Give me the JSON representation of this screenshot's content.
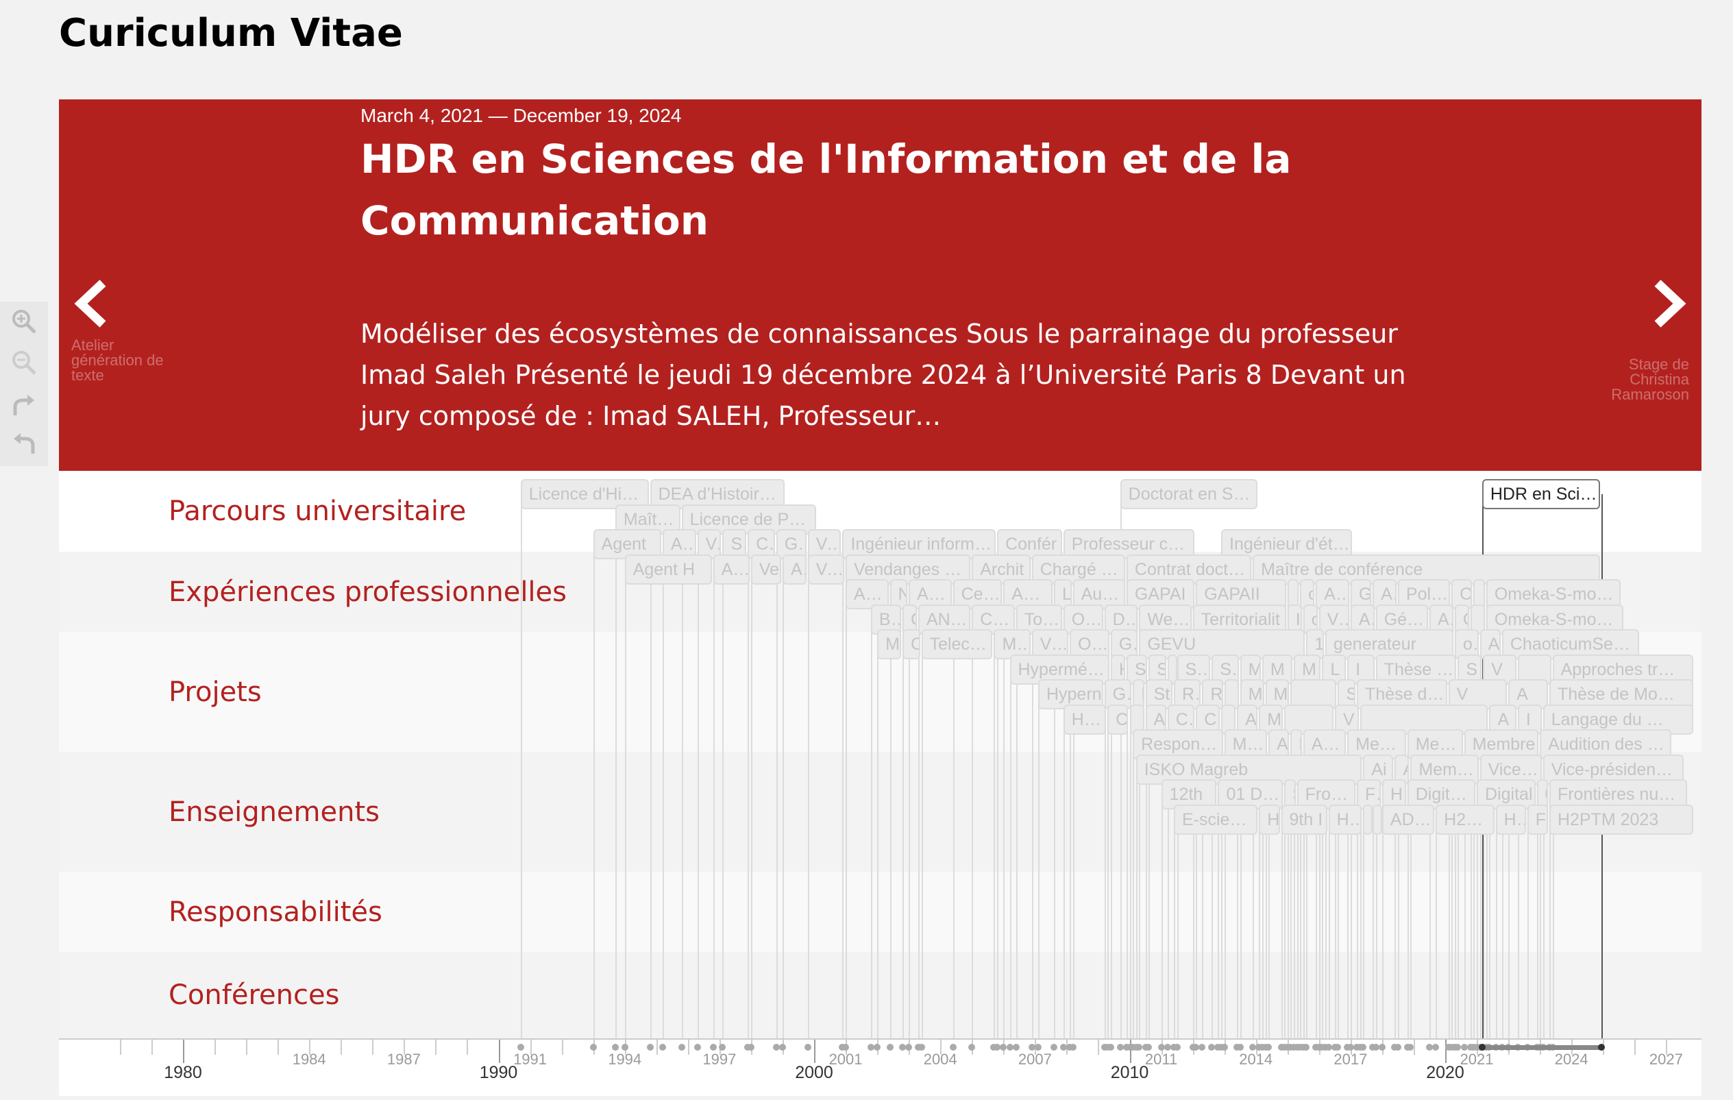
{
  "page_title": "Curiculum Vitae",
  "slide": {
    "date_start": "March 4, 2021",
    "date_sep": "—",
    "date_end": "December 19, 2024",
    "headline": "HDR en Sciences de l'Information et de la Communication",
    "description": "Modéliser des écosystèmes de connaissances Sous le parrainage du professeur Imad Saleh Présenté le jeudi 19 décembre 2024 à l’Université Paris 8 Devant un jury composé de : Imad SALEH, Professeur…",
    "prev": {
      "icon": "chevron-left-icon",
      "label": "Atelier génération de texte"
    },
    "next": {
      "icon": "chevron-right-icon",
      "label": "Stage de Christina Ramaroson"
    }
  },
  "zoom_tools": [
    "zoom-in-icon",
    "zoom-out-icon",
    "redo-icon",
    "undo-icon"
  ],
  "groups": [
    {
      "label": "Parcours universitaire"
    },
    {
      "label": "Expériences professionnelles"
    },
    {
      "label": "Projets"
    },
    {
      "label": "Enseignements"
    },
    {
      "label": "Responsabilités"
    },
    {
      "label": "Conférences"
    }
  ],
  "timeline": {
    "start_year": 1976.0,
    "end_year": 2028.0,
    "active_event": {
      "text": "HDR en Scien…",
      "start": 2021.17,
      "end": 2024.96
    },
    "events": [
      {
        "row": 0,
        "text": "Licence d'Hist…",
        "start": 1990.7,
        "end": 1994.8
      },
      {
        "row": 0,
        "text": "DEA d’Histoir…",
        "start": 1994.8,
        "end": 1999.1
      },
      {
        "row": 0,
        "text": "Doctorat en S…",
        "start": 2009.7,
        "end": 2014.1
      },
      {
        "row": 1,
        "text": "Maîtrise",
        "start": 1993.7,
        "end": 1995.8
      },
      {
        "row": 1,
        "text": "Licence de Ph…",
        "start": 1995.8,
        "end": 2000.1
      },
      {
        "row": 2,
        "text": "Agent",
        "start": 1993.0,
        "end": 1995.2
      },
      {
        "row": 2,
        "text": "Agen",
        "start": 1995.2,
        "end": 1996.3
      },
      {
        "row": 2,
        "text": "Ve",
        "start": 1996.3,
        "end": 1997.1
      },
      {
        "row": 2,
        "text": "Se",
        "start": 1997.1,
        "end": 1997.9
      },
      {
        "row": 2,
        "text": "Ch",
        "start": 1997.9,
        "end": 1998.8
      },
      {
        "row": 2,
        "text": "Gui",
        "start": 1998.8,
        "end": 1999.8
      },
      {
        "row": 2,
        "text": "Vend",
        "start": 1999.8,
        "end": 2000.9
      },
      {
        "row": 2,
        "text": "Ingénieur inform…",
        "start": 2000.9,
        "end": 2005.8
      },
      {
        "row": 2,
        "text": "Confér",
        "start": 2005.8,
        "end": 2007.9
      },
      {
        "row": 2,
        "text": "Professeur co…",
        "start": 2007.9,
        "end": 2012.1
      },
      {
        "row": 2,
        "text": "Ingénieur d'ét…",
        "start": 2012.9,
        "end": 2017.1
      },
      {
        "row": 3,
        "text": "Agent H",
        "start": 1994.0,
        "end": 1996.8
      },
      {
        "row": 3,
        "text": "Age",
        "start": 1996.8,
        "end": 1998.0
      },
      {
        "row": 3,
        "text": "Ve",
        "start": 1998.0,
        "end": 1999.0
      },
      {
        "row": 3,
        "text": "Ar",
        "start": 1999.0,
        "end": 1999.8
      },
      {
        "row": 3,
        "text": "Vendan",
        "start": 1999.8,
        "end": 2001.0
      },
      {
        "row": 3,
        "text": "Vendanges e…",
        "start": 2001.0,
        "end": 2005.0
      },
      {
        "row": 3,
        "text": "Archit",
        "start": 2005.0,
        "end": 2006.9
      },
      {
        "row": 3,
        "text": "Chargé de c",
        "start": 2006.9,
        "end": 2009.9
      },
      {
        "row": 3,
        "text": "Contrat docto…",
        "start": 2009.9,
        "end": 2013.9
      },
      {
        "row": 3,
        "text": "Maître de conférence",
        "start": 2013.9,
        "end": 2024.96
      },
      {
        "row": 4,
        "text": "Agen",
        "start": 2001.0,
        "end": 2002.4
      },
      {
        "row": 4,
        "text": "N",
        "start": 2002.4,
        "end": 2003.0
      },
      {
        "row": 4,
        "text": "ANPE",
        "start": 2003.0,
        "end": 2004.4
      },
      {
        "row": 4,
        "text": "Cegete",
        "start": 2004.4,
        "end": 2006.0
      },
      {
        "row": 4,
        "text": "ANPE",
        "start": 2006.0,
        "end": 2007.6
      },
      {
        "row": 4,
        "text": "Li",
        "start": 2007.6,
        "end": 2008.2
      },
      {
        "row": 4,
        "text": "Autom",
        "start": 2008.2,
        "end": 2009.9
      },
      {
        "row": 4,
        "text": "GAPAI",
        "start": 2009.9,
        "end": 2012.1
      },
      {
        "row": 4,
        "text": "GAPAII",
        "start": 2012.1,
        "end": 2015.0
      },
      {
        "row": 4,
        "text": "",
        "start": 2015.0,
        "end": 2015.4
      },
      {
        "row": 4,
        "text": "c",
        "start": 2015.4,
        "end": 2015.9
      },
      {
        "row": 4,
        "text": "Ate",
        "start": 2015.9,
        "end": 2017.0
      },
      {
        "row": 4,
        "text": "Ge",
        "start": 2017.0,
        "end": 2017.7
      },
      {
        "row": 4,
        "text": "AD",
        "start": 2017.7,
        "end": 2018.5
      },
      {
        "row": 4,
        "text": "Polem",
        "start": 2018.5,
        "end": 2020.2
      },
      {
        "row": 4,
        "text": "O",
        "start": 2020.2,
        "end": 2020.9
      },
      {
        "row": 4,
        "text": "",
        "start": 2020.9,
        "end": 2021.3
      },
      {
        "row": 4,
        "text": "Omeka-S-mo…",
        "start": 2021.3,
        "end": 2025.6
      },
      {
        "row": 5,
        "text": "Ba",
        "start": 2001.8,
        "end": 2002.8
      },
      {
        "row": 5,
        "text": "C",
        "start": 2002.8,
        "end": 2003.3
      },
      {
        "row": 5,
        "text": "ANPE -",
        "start": 2003.3,
        "end": 2005.0
      },
      {
        "row": 5,
        "text": "Cege",
        "start": 2005.0,
        "end": 2006.4
      },
      {
        "row": 5,
        "text": "Touri",
        "start": 2006.4,
        "end": 2007.9
      },
      {
        "row": 5,
        "text": "Outil",
        "start": 2007.9,
        "end": 2009.2
      },
      {
        "row": 5,
        "text": "Diag",
        "start": 2009.2,
        "end": 2010.3
      },
      {
        "row": 5,
        "text": "WebSt",
        "start": 2010.3,
        "end": 2012.0
      },
      {
        "row": 5,
        "text": "Territorialit",
        "start": 2012.0,
        "end": 2015.0
      },
      {
        "row": 5,
        "text": "I",
        "start": 2015.0,
        "end": 2015.5
      },
      {
        "row": 5,
        "text": "o",
        "start": 2015.5,
        "end": 2016.0
      },
      {
        "row": 5,
        "text": "Vis",
        "start": 2016.0,
        "end": 2017.0
      },
      {
        "row": 5,
        "text": "At",
        "start": 2017.0,
        "end": 2017.8
      },
      {
        "row": 5,
        "text": "Génér",
        "start": 2017.8,
        "end": 2019.5
      },
      {
        "row": 5,
        "text": "Ar",
        "start": 2019.5,
        "end": 2020.3
      },
      {
        "row": 5,
        "text": "C",
        "start": 2020.3,
        "end": 2020.8
      },
      {
        "row": 5,
        "text": "",
        "start": 2020.8,
        "end": 2021.3
      },
      {
        "row": 5,
        "text": "Omeka-S-mo…",
        "start": 2021.3,
        "end": 2025.7
      },
      {
        "row": 6,
        "text": "M",
        "start": 2002.0,
        "end": 2002.8
      },
      {
        "row": 6,
        "text": "C",
        "start": 2002.8,
        "end": 2003.4
      },
      {
        "row": 6,
        "text": "Telecom",
        "start": 2003.4,
        "end": 2005.7
      },
      {
        "row": 6,
        "text": "MUI",
        "start": 2005.7,
        "end": 2006.9
      },
      {
        "row": 6,
        "text": "Visit",
        "start": 2006.9,
        "end": 2008.1
      },
      {
        "row": 6,
        "text": "Onad",
        "start": 2008.1,
        "end": 2009.4
      },
      {
        "row": 6,
        "text": "Ges",
        "start": 2009.4,
        "end": 2010.3
      },
      {
        "row": 6,
        "text": "GEVU",
        "start": 2010.3,
        "end": 2015.6
      },
      {
        "row": 6,
        "text": "1",
        "start": 2015.6,
        "end": 2016.2
      },
      {
        "row": 6,
        "text": "generateur",
        "start": 2016.2,
        "end": 2020.3
      },
      {
        "row": 6,
        "text": "on",
        "start": 2020.3,
        "end": 2021.1
      },
      {
        "row": 6,
        "text": "A",
        "start": 2021.1,
        "end": 2021.8
      },
      {
        "row": 6,
        "text": "ChaoticumSe…",
        "start": 2021.8,
        "end": 2026.2
      },
      {
        "row": 7,
        "text": "Hypermédia",
        "start": 2006.2,
        "end": 2009.4
      },
      {
        "row": 7,
        "text": "H",
        "start": 2009.4,
        "end": 2009.9
      },
      {
        "row": 7,
        "text": "S",
        "start": 2009.9,
        "end": 2010.6
      },
      {
        "row": 7,
        "text": "S",
        "start": 2010.6,
        "end": 2011.2
      },
      {
        "row": 7,
        "text": "H",
        "start": 2011.2,
        "end": 2011.5
      },
      {
        "row": 7,
        "text": "Sta",
        "start": 2011.5,
        "end": 2012.6
      },
      {
        "row": 7,
        "text": "Sta",
        "start": 2012.6,
        "end": 2013.5
      },
      {
        "row": 7,
        "text": "M",
        "start": 2013.5,
        "end": 2014.2
      },
      {
        "row": 7,
        "text": "M",
        "start": 2014.2,
        "end": 2015.2
      },
      {
        "row": 7,
        "text": "M",
        "start": 2015.2,
        "end": 2016.1
      },
      {
        "row": 7,
        "text": "L",
        "start": 2016.1,
        "end": 2016.9
      },
      {
        "row": 7,
        "text": "I",
        "start": 2016.9,
        "end": 2017.8
      },
      {
        "row": 7,
        "text": "Thèse d…",
        "start": 2017.8,
        "end": 2020.4
      },
      {
        "row": 7,
        "text": "S",
        "start": 2020.4,
        "end": 2021.2
      },
      {
        "row": 7,
        "text": "V",
        "start": 2021.2,
        "end": 2022.3
      },
      {
        "row": 7,
        "text": "",
        "start": 2022.3,
        "end": 2023.4
      },
      {
        "row": 7,
        "text": "Approches tr…",
        "start": 2023.4,
        "end": 2027.9
      },
      {
        "row": 8,
        "text": "Hypern",
        "start": 2007.1,
        "end": 2009.2
      },
      {
        "row": 8,
        "text": "Ge",
        "start": 2009.2,
        "end": 2010.1
      },
      {
        "row": 8,
        "text": "I",
        "start": 2010.1,
        "end": 2010.5
      },
      {
        "row": 8,
        "text": "St",
        "start": 2010.5,
        "end": 2011.4
      },
      {
        "row": 8,
        "text": "Rer",
        "start": 2011.4,
        "end": 2012.3
      },
      {
        "row": 8,
        "text": "Ro",
        "start": 2012.3,
        "end": 2013.0
      },
      {
        "row": 8,
        "text": "",
        "start": 2013.0,
        "end": 2013.5
      },
      {
        "row": 8,
        "text": "M",
        "start": 2013.5,
        "end": 2014.3
      },
      {
        "row": 8,
        "text": "M",
        "start": 2014.3,
        "end": 2015.1
      },
      {
        "row": 8,
        "text": "",
        "start": 2015.1,
        "end": 2016.6
      },
      {
        "row": 8,
        "text": "S",
        "start": 2016.6,
        "end": 2017.2
      },
      {
        "row": 8,
        "text": "Thèse de A",
        "start": 2017.2,
        "end": 2020.1
      },
      {
        "row": 8,
        "text": "V",
        "start": 2020.1,
        "end": 2022.0
      },
      {
        "row": 8,
        "text": "A",
        "start": 2022.0,
        "end": 2023.3
      },
      {
        "row": 8,
        "text": "Thèse de Mo…",
        "start": 2023.3,
        "end": 2027.9
      },
      {
        "row": 9,
        "text": "Hype",
        "start": 2007.9,
        "end": 2009.3
      },
      {
        "row": 9,
        "text": "C",
        "start": 2009.3,
        "end": 2010.0
      },
      {
        "row": 9,
        "text": "",
        "start": 2010.0,
        "end": 2010.5
      },
      {
        "row": 9,
        "text": "Al",
        "start": 2010.5,
        "end": 2011.2
      },
      {
        "row": 9,
        "text": "Cor",
        "start": 2011.2,
        "end": 2012.1
      },
      {
        "row": 9,
        "text": "Co",
        "start": 2012.1,
        "end": 2012.9
      },
      {
        "row": 9,
        "text": "",
        "start": 2012.9,
        "end": 2013.4
      },
      {
        "row": 9,
        "text": "Al",
        "start": 2013.4,
        "end": 2014.1
      },
      {
        "row": 9,
        "text": "M",
        "start": 2014.1,
        "end": 2014.9
      },
      {
        "row": 9,
        "text": "",
        "start": 2014.9,
        "end": 2016.5
      },
      {
        "row": 9,
        "text": "V",
        "start": 2016.5,
        "end": 2017.3
      },
      {
        "row": 9,
        "text": "",
        "start": 2017.3,
        "end": 2021.4
      },
      {
        "row": 9,
        "text": "A",
        "start": 2021.4,
        "end": 2022.3
      },
      {
        "row": 9,
        "text": "I",
        "start": 2022.3,
        "end": 2023.1
      },
      {
        "row": 9,
        "text": "Langage du …",
        "start": 2023.1,
        "end": 2027.9
      },
      {
        "row": 10,
        "text": "Responsab",
        "start": 2010.1,
        "end": 2013.0
      },
      {
        "row": 10,
        "text": "Mem",
        "start": 2013.0,
        "end": 2014.4
      },
      {
        "row": 10,
        "text": "A(",
        "start": 2014.4,
        "end": 2015.1
      },
      {
        "row": 10,
        "text": "M",
        "start": 2015.1,
        "end": 2015.5
      },
      {
        "row": 10,
        "text": "Audi",
        "start": 2015.5,
        "end": 2016.9
      },
      {
        "row": 10,
        "text": "Membr",
        "start": 2016.9,
        "end": 2018.8
      },
      {
        "row": 10,
        "text": "Membr",
        "start": 2018.8,
        "end": 2020.6
      },
      {
        "row": 10,
        "text": "Membre",
        "start": 2020.6,
        "end": 2023.0
      },
      {
        "row": 10,
        "text": "Audition des …",
        "start": 2023.0,
        "end": 2027.2
      },
      {
        "row": 11,
        "text": "ISKO Magreb",
        "start": 2010.2,
        "end": 2017.4
      },
      {
        "row": 11,
        "text": "Ai",
        "start": 2017.4,
        "end": 2018.4
      },
      {
        "row": 11,
        "text": "A",
        "start": 2018.4,
        "end": 2018.9
      },
      {
        "row": 11,
        "text": "Membre",
        "start": 2018.9,
        "end": 2021.1
      },
      {
        "row": 11,
        "text": "Vice-pr",
        "start": 2021.1,
        "end": 2023.1
      },
      {
        "row": 11,
        "text": "Vice-présiden…",
        "start": 2023.1,
        "end": 2027.6
      },
      {
        "row": 12,
        "text": "12th",
        "start": 2011.0,
        "end": 2012.8
      },
      {
        "row": 12,
        "text": "01 Desi",
        "start": 2012.8,
        "end": 2014.9
      },
      {
        "row": 12,
        "text": "S",
        "start": 2014.9,
        "end": 2015.3
      },
      {
        "row": 12,
        "text": "Frontiè",
        "start": 2015.3,
        "end": 2017.2
      },
      {
        "row": 12,
        "text": "Fr(",
        "start": 2017.2,
        "end": 2018.0
      },
      {
        "row": 12,
        "text": "H2",
        "start": 2018.0,
        "end": 2018.8
      },
      {
        "row": 12,
        "text": "Digital T",
        "start": 2018.8,
        "end": 2021.0
      },
      {
        "row": 12,
        "text": "Digital",
        "start": 2021.0,
        "end": 2022.9
      },
      {
        "row": 12,
        "text": "0",
        "start": 2022.9,
        "end": 2023.3
      },
      {
        "row": 12,
        "text": "Frontières nu…",
        "start": 2023.3,
        "end": 2027.7
      },
      {
        "row": 13,
        "text": "E-science",
        "start": 2011.4,
        "end": 2014.1
      },
      {
        "row": 13,
        "text": "H",
        "start": 2014.1,
        "end": 2014.8
      },
      {
        "row": 13,
        "text": "9th I",
        "start": 2014.8,
        "end": 2016.3
      },
      {
        "row": 13,
        "text": "H2F",
        "start": 2016.3,
        "end": 2017.4
      },
      {
        "row": 13,
        "text": "J",
        "start": 2017.4,
        "end": 2017.7
      },
      {
        "row": 13,
        "text": "(",
        "start": 2017.7,
        "end": 2018.0
      },
      {
        "row": 13,
        "text": "ADACE",
        "start": 2018.0,
        "end": 2019.7
      },
      {
        "row": 13,
        "text": "H2PTM",
        "start": 2019.7,
        "end": 2021.6
      },
      {
        "row": 13,
        "text": "H2F",
        "start": 2021.6,
        "end": 2022.6
      },
      {
        "row": 13,
        "text": "Fro",
        "start": 2022.6,
        "end": 2023.3
      },
      {
        "row": 13,
        "text": "H2PTM 2023",
        "start": 2023.3,
        "end": 2027.9
      }
    ],
    "minor_ticks": [
      "1984",
      "1987",
      "1991",
      "1994",
      "1997",
      "2001",
      "2004",
      "2007",
      "2011",
      "2014",
      "2017",
      "2021",
      "2024",
      "2027"
    ],
    "major_ticks": [
      "1980",
      "1990",
      "2000",
      "2010",
      "2020"
    ]
  }
}
